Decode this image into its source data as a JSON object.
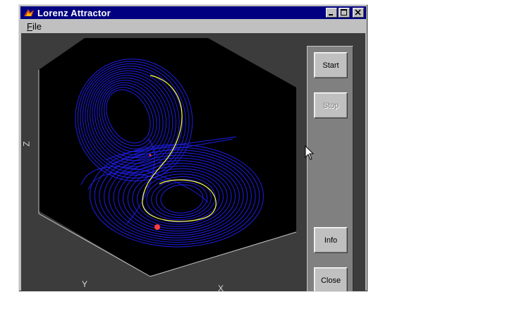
{
  "window": {
    "title": "Lorenz Attractor",
    "menu": [
      {
        "label": "File",
        "mnemonic": "F",
        "rest": "ile"
      }
    ],
    "controls": [
      "minimize-icon",
      "maximize-icon",
      "close-icon"
    ]
  },
  "plot": {
    "axis_labels": {
      "x": "X",
      "y": "Y",
      "z": "Z"
    },
    "colors": {
      "background": "#000000",
      "trajectory": "#1e1ee6",
      "current_segment": "#ffff3c",
      "marker": "#ff3b3b",
      "frame": "#c8c8c8"
    }
  },
  "buttons": {
    "start": {
      "label": "Start",
      "enabled": true
    },
    "stop": {
      "label": "Stop",
      "enabled": false
    },
    "info": {
      "label": "Info",
      "enabled": true
    },
    "close": {
      "label": "Close",
      "enabled": true
    }
  }
}
